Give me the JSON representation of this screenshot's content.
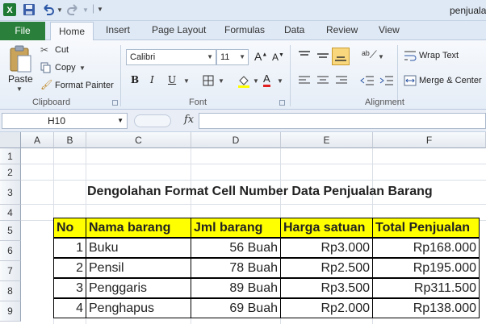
{
  "app": {
    "title": "penjuala"
  },
  "ribbon_tabs": [
    "File",
    "Home",
    "Insert",
    "Page Layout",
    "Formulas",
    "Data",
    "Review",
    "View"
  ],
  "clipboard": {
    "paste": "Paste",
    "cut": "Cut",
    "copy": "Copy",
    "format_painter": "Format Painter",
    "label": "Clipboard"
  },
  "font": {
    "name": "Calibri",
    "size": "11",
    "bold": "B",
    "italic": "I",
    "underline": "U",
    "label": "Font"
  },
  "alignment": {
    "wrap_text": "Wrap Text",
    "merge_center": "Merge & Center",
    "label": "Alignment"
  },
  "formula_bar": {
    "name_box": "H10",
    "fx": "fx",
    "value": ""
  },
  "columns": [
    "A",
    "B",
    "C",
    "D",
    "E",
    "F"
  ],
  "rows": [
    "1",
    "2",
    "3",
    "4",
    "5",
    "6",
    "7",
    "8",
    "9"
  ],
  "sheet": {
    "heading": "Dengolahan Format Cell Number Data Penjualan Barang",
    "headers": [
      "No",
      "Nama barang",
      "Jml barang",
      "Harga satuan",
      "Total Penjualan"
    ],
    "data": [
      [
        "1",
        "Buku",
        "56 Buah",
        "Rp3.000",
        "Rp168.000"
      ],
      [
        "2",
        "Pensil",
        "78 Buah",
        "Rp2.500",
        "Rp195.000"
      ],
      [
        "3",
        "Penggaris",
        "89 Buah",
        "Rp3.500",
        "Rp311.500"
      ],
      [
        "4",
        "Penghapus",
        "69 Buah",
        "Rp2.000",
        "Rp138.000"
      ]
    ]
  },
  "colors": {
    "file_tab": "#2a7f3b",
    "header_fill": "#ffff00",
    "ribbon_bg": "#dfe9f5"
  }
}
